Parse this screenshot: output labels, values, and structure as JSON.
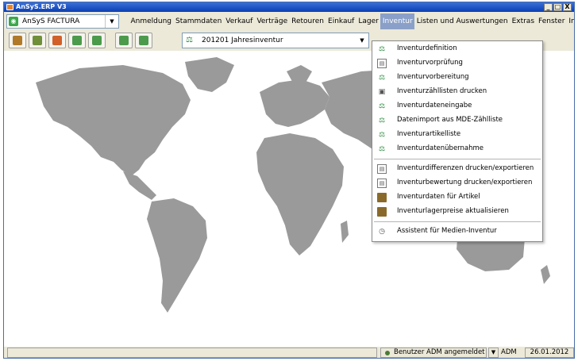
{
  "window": {
    "title": "AnSyS.ERP V3",
    "controls": [
      "_",
      "□",
      "X"
    ]
  },
  "app_selector": {
    "value": "AnSyS FACTURA"
  },
  "menu_items": [
    "Anmeldung",
    "Stammdaten",
    "Verkauf",
    "Verträge",
    "Retouren",
    "Einkauf",
    "Lager",
    "Inventur",
    "Listen und Auswertungen",
    "Extras",
    "Fenster",
    "Info"
  ],
  "active_menu": "Inventur",
  "inventory_selector": {
    "value": "201201 Jahresinventur"
  },
  "inventur_menu": {
    "groups": [
      [
        {
          "label": "Inventurdefinition",
          "icon": "scale-icon"
        },
        {
          "label": "Inventurvorprüfung",
          "icon": "sheet-icon"
        },
        {
          "label": "Inventurvorbereitung",
          "icon": "scale-icon"
        },
        {
          "label": "Inventurzähllisten drucken",
          "icon": "print-icon"
        },
        {
          "label": "Inventurdateneingabe",
          "icon": "scale-icon"
        },
        {
          "label": "Datenimport aus MDE-Zählliste",
          "icon": "scale-icon"
        },
        {
          "label": "Inventurartikelliste",
          "icon": "scale-icon"
        },
        {
          "label": "Inventurdatenübernahme",
          "icon": "scale-icon"
        }
      ],
      [
        {
          "label": "Inventurdifferenzen drucken/exportieren",
          "icon": "sheet-icon"
        },
        {
          "label": "Inventurbewertung drucken/exportieren",
          "icon": "sheet-icon"
        },
        {
          "label": "Inventurdaten für Artikel",
          "icon": "box-icon"
        },
        {
          "label": "Inventurlagerpreise aktualisieren",
          "icon": "box-icon"
        }
      ],
      [
        {
          "label": "Assistent für Medien-Inventur",
          "icon": "clock-icon"
        }
      ]
    ]
  },
  "status": {
    "user": "Benutzer ADM angemeldet",
    "user_short": "ADM",
    "date": "26.01.2012"
  }
}
